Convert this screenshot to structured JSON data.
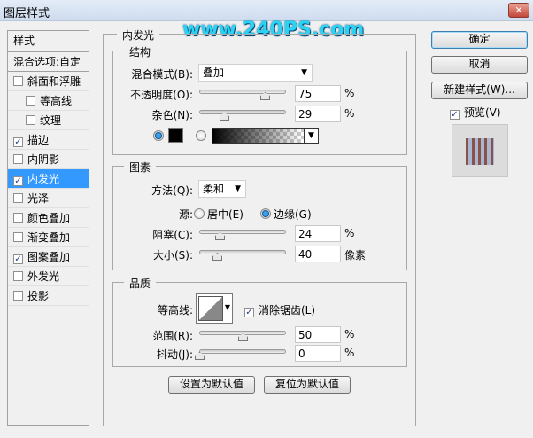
{
  "window": {
    "title": "图层样式",
    "close": "✕"
  },
  "watermark": "www.240PS.com",
  "sidebar": {
    "header": "样式",
    "blend_options": "混合选项:自定",
    "items": [
      {
        "label": "斜面和浮雕",
        "checked": false,
        "indent": false
      },
      {
        "label": "等高线",
        "checked": false,
        "indent": true
      },
      {
        "label": "纹理",
        "checked": false,
        "indent": true
      },
      {
        "label": "描边",
        "checked": true,
        "indent": false
      },
      {
        "label": "内阴影",
        "checked": false,
        "indent": false
      },
      {
        "label": "内发光",
        "checked": true,
        "indent": false,
        "selected": true
      },
      {
        "label": "光泽",
        "checked": false,
        "indent": false
      },
      {
        "label": "颜色叠加",
        "checked": false,
        "indent": false
      },
      {
        "label": "渐变叠加",
        "checked": false,
        "indent": false
      },
      {
        "label": "图案叠加",
        "checked": true,
        "indent": false
      },
      {
        "label": "外发光",
        "checked": false,
        "indent": false
      },
      {
        "label": "投影",
        "checked": false,
        "indent": false
      }
    ]
  },
  "panel": {
    "title": "内发光",
    "structure": {
      "title": "结构",
      "blend_mode_label": "混合模式(B):",
      "blend_mode": "叠加",
      "opacity_label": "不透明度(O):",
      "opacity": "75",
      "noise_label": "杂色(N):",
      "noise": "29",
      "unit": "%",
      "color": "#000000"
    },
    "elements": {
      "title": "图素",
      "method_label": "方法(Q):",
      "method": "柔和",
      "source_label": "源:",
      "source_center": "居中(E)",
      "source_edge": "边缘(G)",
      "choke_label": "阻塞(C):",
      "choke": "24",
      "choke_unit": "%",
      "size_label": "大小(S):",
      "size": "40",
      "size_unit": "像素"
    },
    "quality": {
      "title": "品质",
      "contour_label": "等高线:",
      "antialias_label": "消除锯齿(L)",
      "antialias": true,
      "range_label": "范围(R):",
      "range": "50",
      "jitter_label": "抖动(J):",
      "jitter": "0",
      "unit": "%"
    },
    "set_default": "设置为默认值",
    "reset_default": "复位为默认值"
  },
  "buttons": {
    "ok": "确定",
    "cancel": "取消",
    "new_style": "新建样式(W)...",
    "preview_label": "预览(V)",
    "preview": true
  }
}
